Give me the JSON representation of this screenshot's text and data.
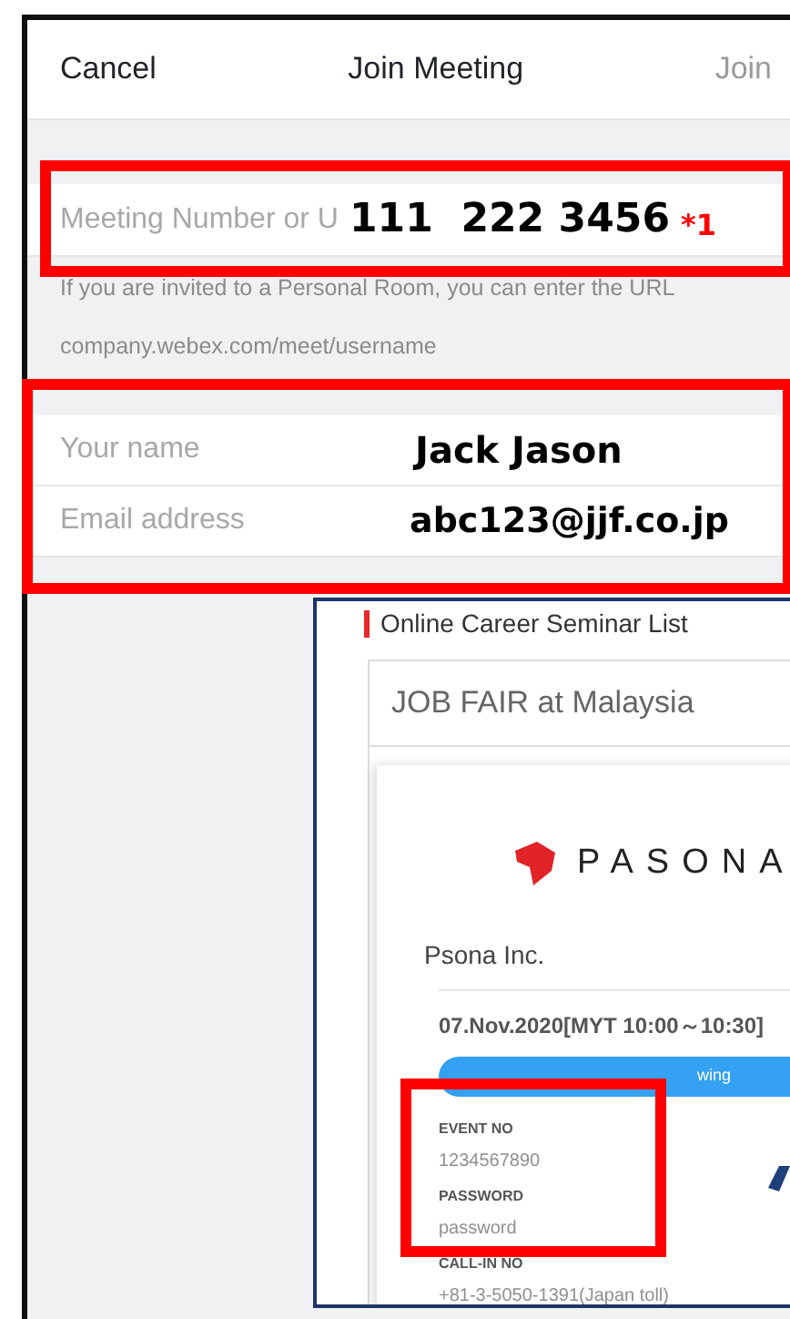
{
  "header": {
    "cancel": "Cancel",
    "title": "Join Meeting",
    "join": {
      "label": "Join",
      "disabled": true
    }
  },
  "meeting_field": {
    "placeholder": "Meeting Number or U",
    "value": "111  222 3456",
    "note_mark": "*1"
  },
  "hint": [
    "If you are invited to a Personal Room, you can enter the URL",
    "company.webex.com/meet/username"
  ],
  "fields": [
    {
      "placeholder": "Your name",
      "value": "Jack Jason"
    },
    {
      "placeholder": "Email address",
      "value": "abc123@jjf.co.jp"
    }
  ],
  "inset": {
    "heading": "Online Career Seminar List",
    "event_title": "JOB FAIR at Malaysia",
    "logo_text": "PASONA",
    "company": "Psona Inc.",
    "date": "07.Nov.2020[MYT 10:00～10:30]",
    "button": "wing",
    "details": [
      {
        "label": "EVENT NO",
        "value": "1234567890"
      },
      {
        "label": "PASSWORD",
        "value": "password"
      },
      {
        "label": "CALL-IN NO",
        "value": "+81-3-5050-1391(Japan toll)"
      }
    ]
  }
}
